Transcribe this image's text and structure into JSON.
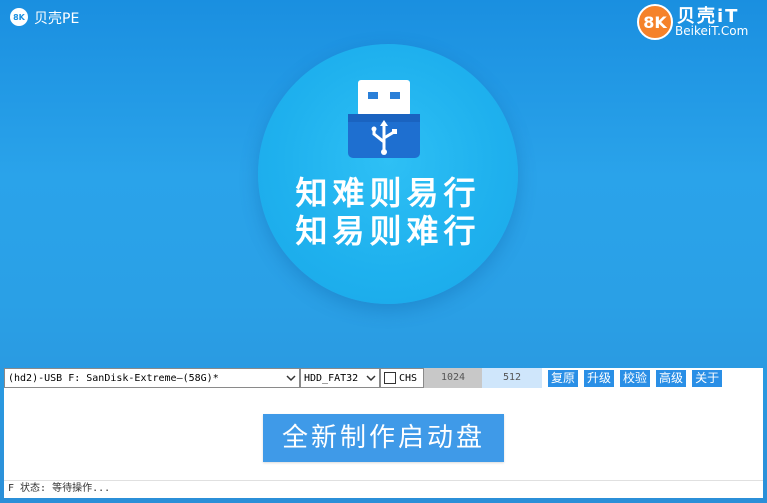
{
  "titlebar": {
    "logo_text": "8K",
    "app_title": "贝壳PE"
  },
  "brand": {
    "badge": "8K",
    "name": "贝壳iT",
    "url": "BeikeiT.Com"
  },
  "hero": {
    "slogan_line1": "知难则易行",
    "slogan_line2": "知易则难行"
  },
  "toolbar": {
    "disk_select_value": "(hd2)-USB F: SanDisk-Extreme—(58G)*",
    "fs_select_value": "HDD_FAT32",
    "chs_label": "CHS",
    "field_1024": "1024",
    "field_512": "512",
    "btn_restore": "复原",
    "btn_upgrade": "升级",
    "btn_verify": "校验",
    "btn_advanced": "高级",
    "btn_about": "关于"
  },
  "main": {
    "create_button_label": "全新制作启动盘"
  },
  "status": {
    "text": "F 状态: 等待操作..."
  },
  "colors": {
    "accent": "#2a8fe6",
    "brand_orange": "#f5822a",
    "hero_blue": "#1fb1ee"
  }
}
